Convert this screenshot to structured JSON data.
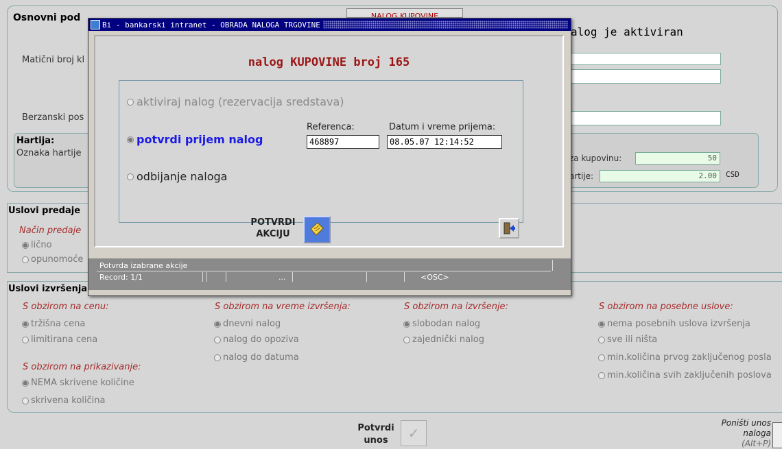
{
  "background": {
    "stamp": "NALOG KUPOVINE",
    "top_section_title": "Osnovni pod",
    "status_text": "alog je aktiviran",
    "maticni_label": "Matični broj kl",
    "berzanski_label": "Berzanski pos",
    "hartija": {
      "title": "Hartija:",
      "oznaka_label": "Oznaka hartije",
      "za_kupovinu_label": "za kupovinu:",
      "za_kupovinu_value": "50",
      "cena_label": "artije:",
      "cena_value": "2.00",
      "currency": "CSD"
    },
    "uslovi_predaje": {
      "title": "Uslovi predaje",
      "subtitle": "Način predaje",
      "options": [
        "lično",
        "opunomoće"
      ]
    },
    "uslovi_izvrsenja": {
      "title": "Uslovi izvršenja",
      "cena": {
        "title": "S obzirom na cenu:",
        "options": [
          "tržišna cena",
          "limitirana cena"
        ]
      },
      "vreme": {
        "title": "S obzirom na vreme izvršenja:",
        "options": [
          "dnevni nalog",
          "nalog do opoziva",
          "nalog do datuma"
        ]
      },
      "izvrsenje": {
        "title": "S obzirom na izvršenje:",
        "options": [
          "slobodan nalog",
          "zajednički nalog"
        ]
      },
      "posebni": {
        "title": "S obzirom na posebne uslove:",
        "options": [
          "nema posebnih uslova izvršenja",
          "sve ili ništa",
          "min.količina prvog zaključenog posla",
          "min.količina svih zaključenih poslova"
        ]
      },
      "prikazivanje": {
        "title": "S obzirom na prikazivanje:",
        "options": [
          "NEMA skrivene količine",
          "skrivena količina"
        ]
      }
    },
    "potvrdi_unos": "Potvrdi unos",
    "ponisti": "Poništi unos naloga",
    "ponisti_shortcut": "(Alt+P)"
  },
  "dialog": {
    "title": "Bi - bankarski intranet - OBRADA NALOGA TRGOVINE",
    "heading": "nalog KUPOVINE broj 165",
    "options": {
      "aktiviraj": "aktiviraj nalog (rezervacija sredstava)",
      "potvrdi": "potvrdi prijem nalog",
      "odbijanje": "odbijanje naloga"
    },
    "referenca_label": "Referenca:",
    "referenca_value": "468897",
    "datum_label": "Datum i vreme prijema:",
    "datum_value": "08.05.07 12:14:52",
    "potvrdi_akciju": "POTVRDI AKCIJU",
    "status": "Potvrda izabrane akcije",
    "record": "Record: 1/1",
    "ellipsis": "...",
    "osc": "<OSC>"
  },
  "colors": {
    "title_bar": "#000080",
    "heading": "#9b1515",
    "selected_option": "#1a1ae6"
  }
}
